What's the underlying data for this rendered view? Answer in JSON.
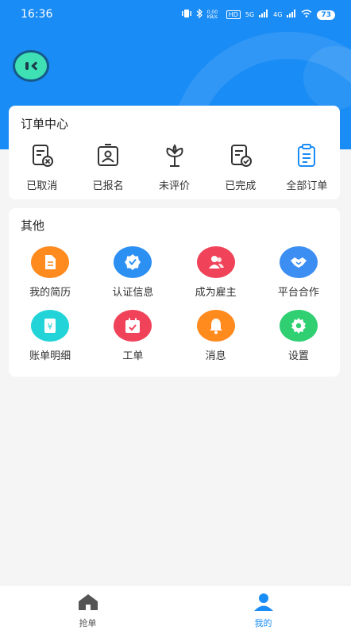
{
  "status_bar": {
    "time": "16:36",
    "net_speed": "0.00 KB/s",
    "hd": "HD",
    "signal_5g": "5G",
    "signal_4g": "4G",
    "battery": "73"
  },
  "order_center": {
    "title": "订单中心",
    "items": [
      {
        "label": "已取消",
        "icon": "cancelled-doc-icon"
      },
      {
        "label": "已报名",
        "icon": "id-badge-icon"
      },
      {
        "label": "未评价",
        "icon": "flower-icon"
      },
      {
        "label": "已完成",
        "icon": "completed-doc-icon"
      },
      {
        "label": "全部订单",
        "icon": "clipboard-icon"
      }
    ],
    "highlight_color": "#1a8cf5"
  },
  "other": {
    "title": "其他",
    "items": [
      {
        "label": "我的简历",
        "icon": "resume-icon",
        "color": "#ff8a1e"
      },
      {
        "label": "认证信息",
        "icon": "verified-badge-icon",
        "color": "#2c8ff2"
      },
      {
        "label": "成为雇主",
        "icon": "users-icon",
        "color": "#f0435a"
      },
      {
        "label": "平台合作",
        "icon": "handshake-icon",
        "color": "#3d8ef2"
      },
      {
        "label": "账单明细",
        "icon": "bill-icon",
        "color": "#22d3d8"
      },
      {
        "label": "工单",
        "icon": "calendar-check-icon",
        "color": "#f0435a"
      },
      {
        "label": "消息",
        "icon": "bell-icon",
        "color": "#ff8a1e"
      },
      {
        "label": "设置",
        "icon": "gear-icon",
        "color": "#2fcf72"
      }
    ]
  },
  "tabbar": {
    "tabs": [
      {
        "label": "抢单",
        "icon": "home-icon",
        "active": false
      },
      {
        "label": "我的",
        "icon": "user-icon",
        "active": true
      }
    ],
    "active_color": "#1a8cf5",
    "inactive_color": "#555555"
  }
}
